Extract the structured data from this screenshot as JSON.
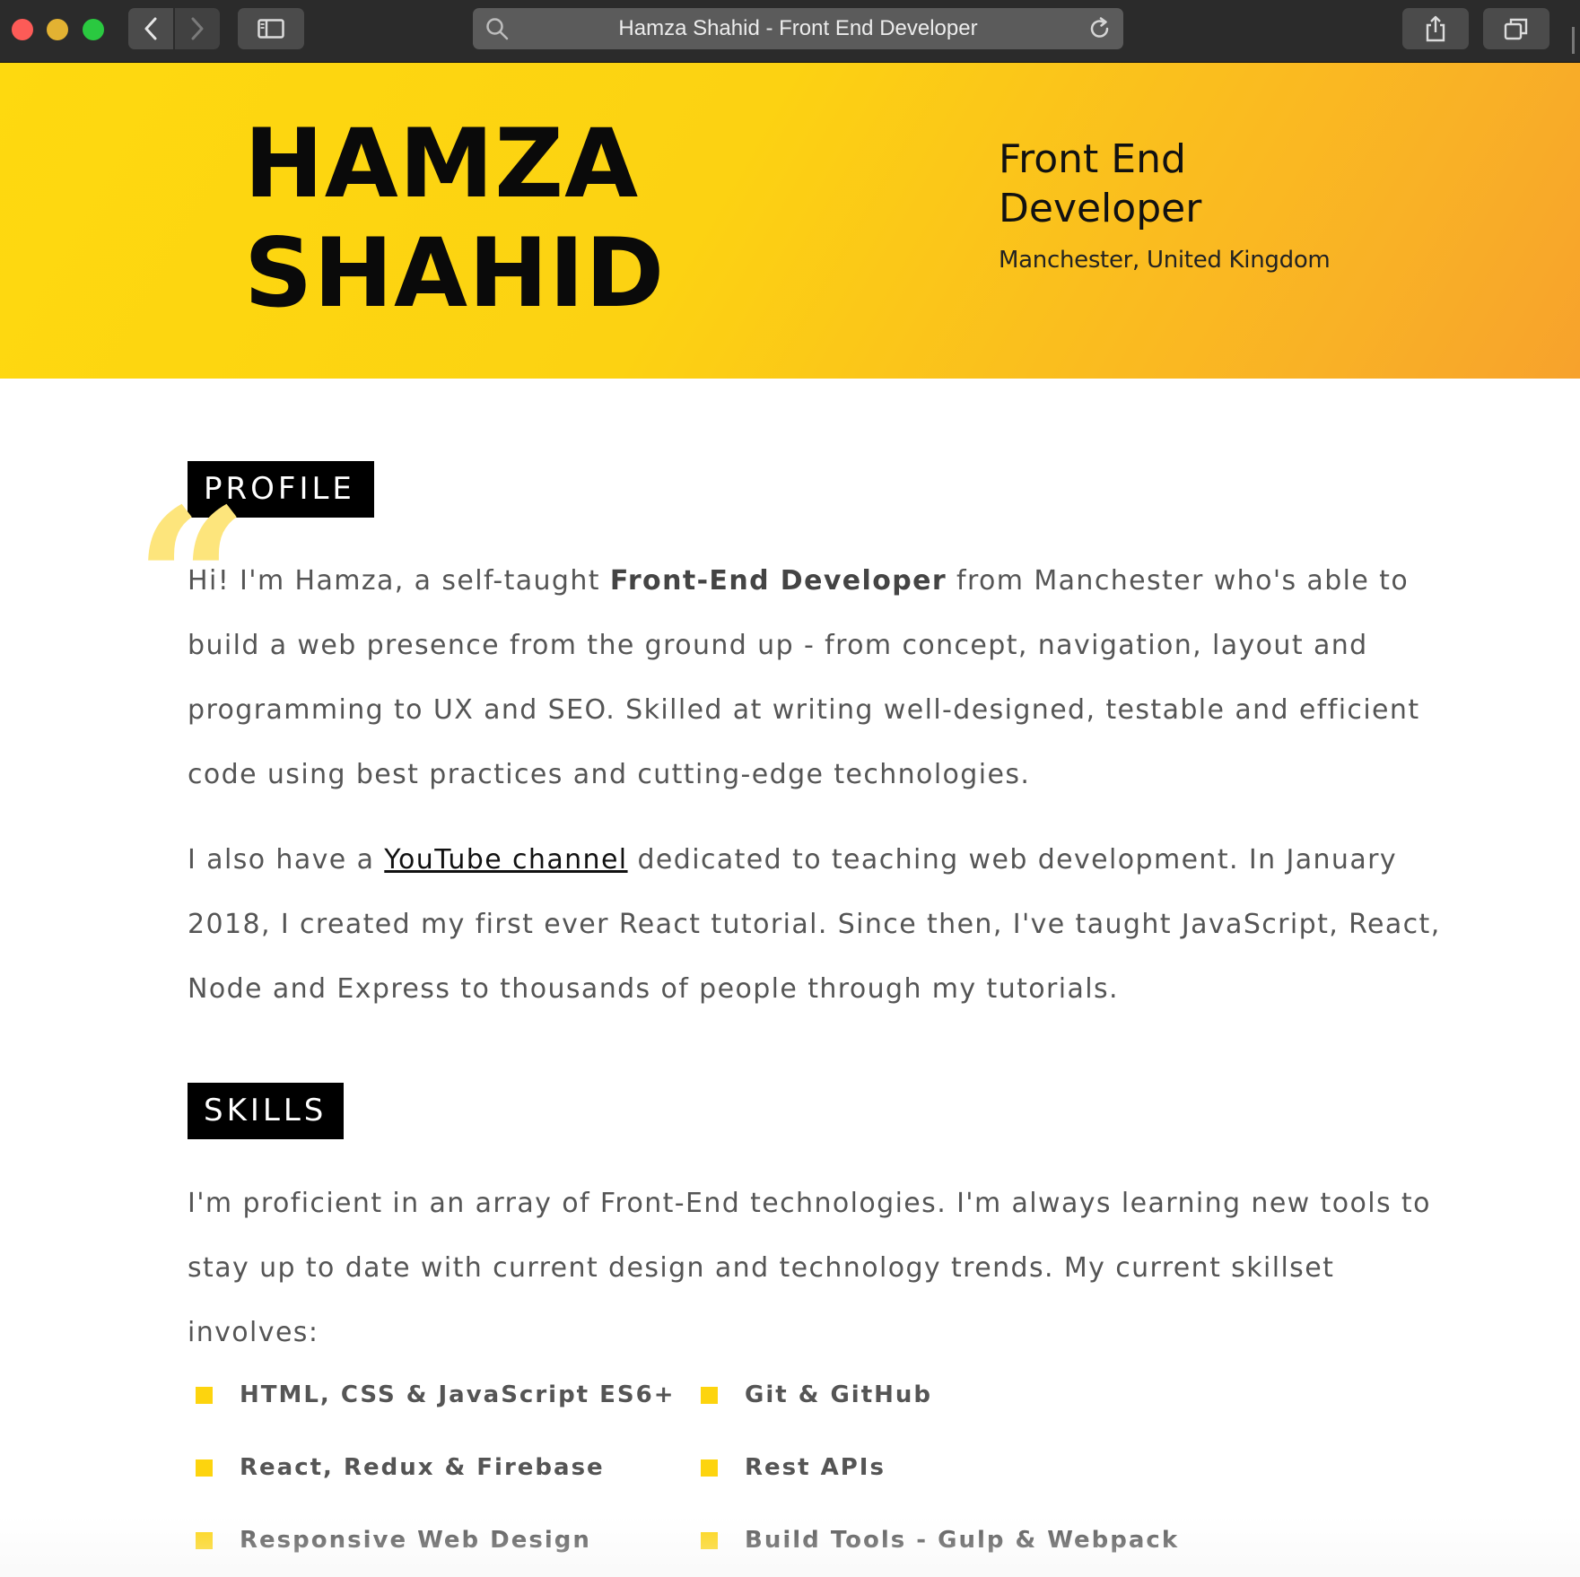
{
  "browser": {
    "tab_title": "Hamza Shahid - Front End Developer"
  },
  "header": {
    "first_name": "HAMZA",
    "last_name": "SHAHID",
    "role_line1": "Front End",
    "role_line2": "Developer",
    "location": "Manchester, United Kingdom"
  },
  "profile": {
    "heading": "PROFILE",
    "p1_before": "Hi! I'm Hamza, a self-taught ",
    "p1_bold": "Front-End Developer",
    "p1_after": " from Manchester who's able to build a web presence from the ground up - from concept, navigation, layout and programming to UX and SEO. Skilled at writing well-designed, testable and efficient code using best practices and cutting-edge technologies.",
    "p2_before": "I also have a ",
    "p2_link": "YouTube channel",
    "p2_after": " dedicated to teaching web development. In January 2018, I created my first ever React tutorial. Since then, I've taught JavaScript, React, Node and Express to thousands of people through my tutorials."
  },
  "skills": {
    "heading": "SKILLS",
    "intro": "I'm proficient in an array of Front-End technologies. I'm always learning new tools to stay up to date with current design and technology trends. My current skillset involves:",
    "items": [
      "HTML, CSS & JavaScript ES6+",
      "Git & GitHub",
      "React, Redux & Firebase",
      "Rest APIs",
      "Responsive Web Design",
      "Build Tools - Gulp & Webpack"
    ]
  },
  "icons": {
    "quote": "quote-icon",
    "bullet": "square-bullet-icon"
  },
  "colors": {
    "accent": "#fdd40e",
    "header_gradient_start": "#fed90f",
    "header_gradient_end": "#f7a22c"
  }
}
